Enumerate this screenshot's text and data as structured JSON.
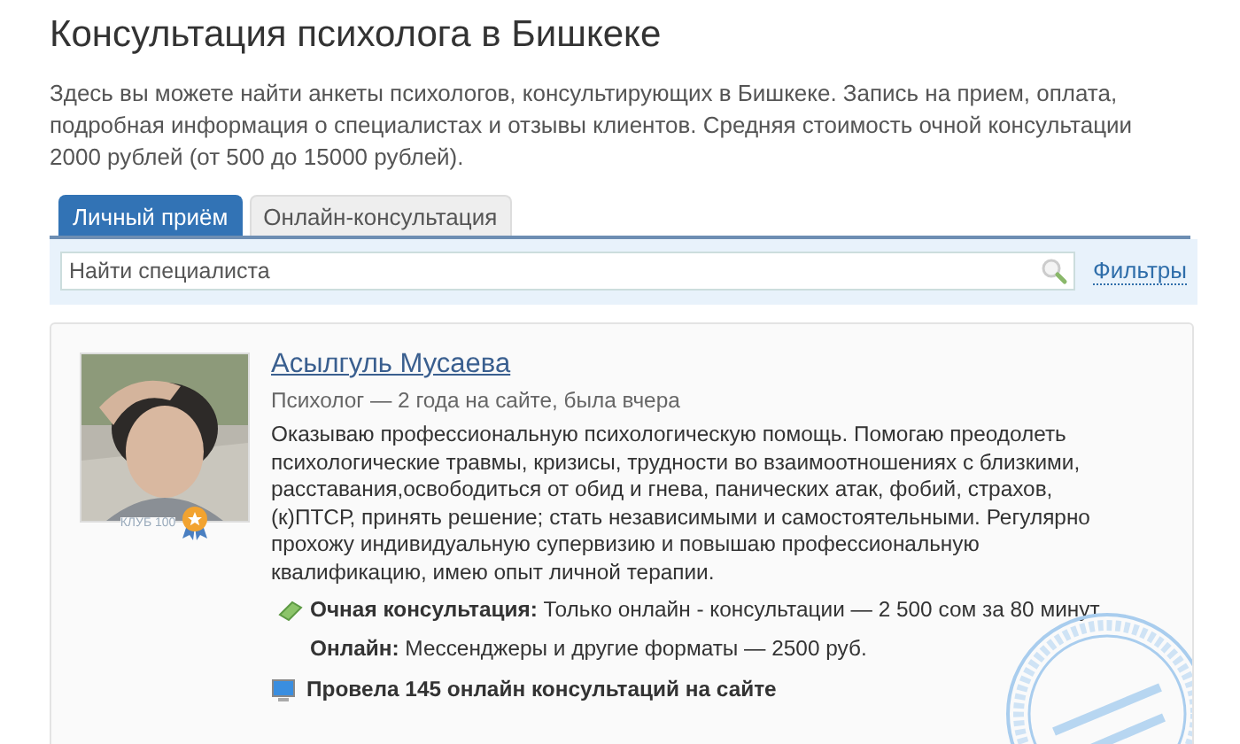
{
  "title": "Консультация психолога в Бишкеке",
  "intro": "Здесь вы можете найти анкеты психологов, консультирующих в Бишкеке. Запись на прием, оплата, подробная информация о специалистах и отзывы клиентов. Средняя стоимость очной консультации 2000 рублей (от 500 до 15000 рублей).",
  "tabs": [
    {
      "label": "Личный приём",
      "selected": true
    },
    {
      "label": "Онлайн-консультация",
      "selected": false
    }
  ],
  "search": {
    "placeholder": "Найти специалиста",
    "filters": "Фильтры"
  },
  "specialists": [
    {
      "club": "КЛУБ 100",
      "name": "Асылгуль Мусаева",
      "meta": "Психолог — 2 года на сайте, была вчера",
      "about": "Оказываю профессиональную психологическую помощь. Помогаю преодолеть психологические травмы, кризисы, трудности во взаимоотношениях с близкими, расставания,освободиться от обид и гнева, панических атак, фобий, страхов, (к)ПТСР, принять решение; стать независимыми и самостоятельными. Регулярно прохожу индивидуальную супервизию и повышаю профессиональную квалификацию, имею опыт личной терапии.",
      "prices": [
        {
          "kind": "money",
          "label": "Очная консультация:",
          "text": "Только онлайн - консультации — 2 500 сом за 80 минут"
        },
        {
          "kind": "plain",
          "label": "Онлайн:",
          "text": "Мессенджеры и другие форматы — 2500 руб."
        }
      ],
      "sessions": "Провела 145 онлайн консультаций на сайте"
    }
  ]
}
